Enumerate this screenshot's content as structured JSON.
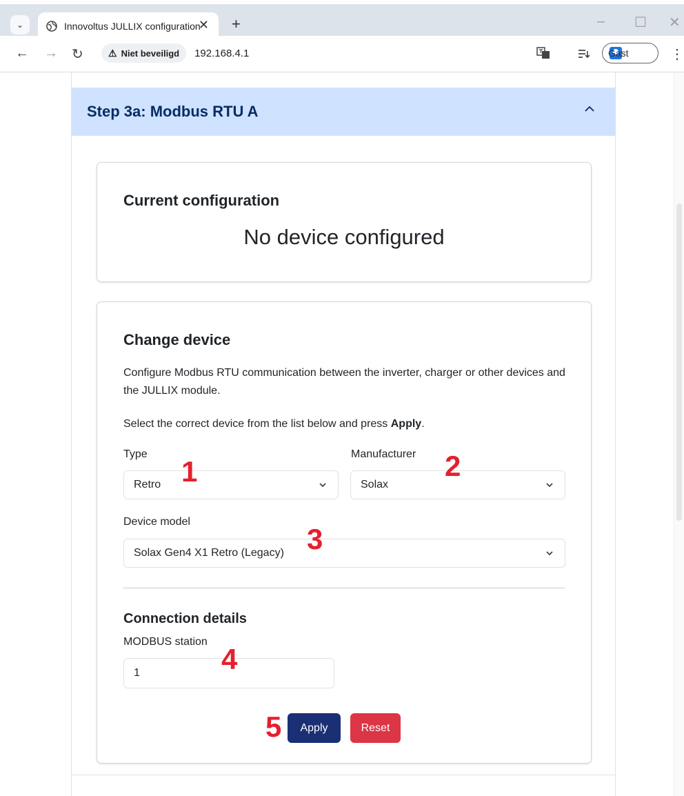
{
  "browser": {
    "tab_title": "Innovoltus JULLIX configuration",
    "tab_close": "✕",
    "new_tab": "+",
    "security_label": "Niet beveiligd",
    "url": "192.168.4.1",
    "profile_label": "Gast"
  },
  "accordion": {
    "title": "Step 3a: Modbus RTU A"
  },
  "current_config": {
    "heading": "Current configuration",
    "status": "No device configured"
  },
  "change_device": {
    "heading": "Change device",
    "description": "Configure Modbus RTU communication between the inverter, charger or other devices and the JULLIX module.",
    "instruction_prefix": "Select the correct device from the list below and press ",
    "instruction_bold": "Apply",
    "instruction_suffix": ".",
    "type_label": "Type",
    "type_value": "Retro",
    "manufacturer_label": "Manufacturer",
    "manufacturer_value": "Solax",
    "model_label": "Device model",
    "model_value": "Solax Gen4 X1 Retro (Legacy)",
    "connection_heading": "Connection details",
    "station_label": "MODBUS station",
    "station_value": "1",
    "apply_label": "Apply",
    "reset_label": "Reset"
  },
  "markers": [
    "1",
    "2",
    "3",
    "4",
    "5"
  ],
  "colors": {
    "accordion_header_bg": "#cfe2ff",
    "accordion_header_text": "#052c65",
    "apply_button": "#1a2f74",
    "reset_button": "#dc3545",
    "marker": "#e5202e"
  }
}
